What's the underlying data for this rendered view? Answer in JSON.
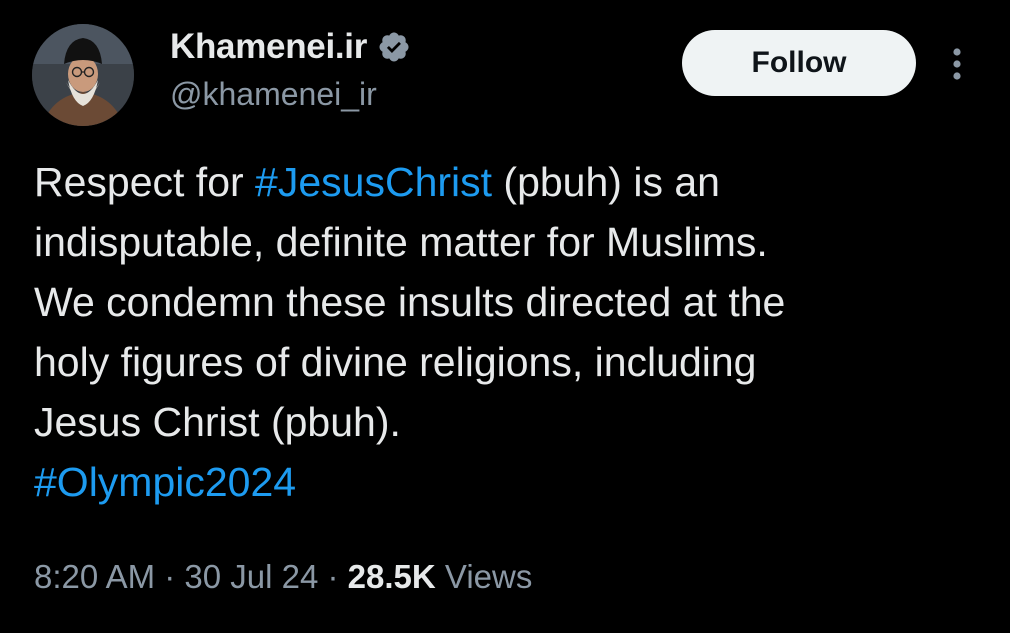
{
  "author": {
    "display_name": "Khamenei.ir",
    "handle": "@khamenei_ir",
    "verified_icon": "verified-badge-icon",
    "avatar": "profile-photo"
  },
  "actions": {
    "follow_label": "Follow",
    "more_icon": "more-vertical-icon"
  },
  "tweet": {
    "lines": [
      {
        "before": "Respect for ",
        "hashtag": "#JesusChrist",
        "after": " (pbuh) is an"
      },
      {
        "text": "indisputable, definite matter for Muslims."
      },
      {
        "text": "We condemn these insults directed at the"
      },
      {
        "text": "holy figures of divine religions, including"
      },
      {
        "text": "Jesus Christ (pbuh)."
      },
      {
        "hashtag": "#Olympic2024"
      }
    ]
  },
  "meta": {
    "time": "8:20 AM",
    "separator": " · ",
    "date": "30 Jul 24",
    "views_count": "28.5K",
    "views_label": " Views"
  },
  "colors": {
    "background": "#000000",
    "text": "#e7e9ea",
    "secondary": "#8b98a5",
    "link": "#1d9bf0",
    "follow_bg": "#eff3f4"
  }
}
